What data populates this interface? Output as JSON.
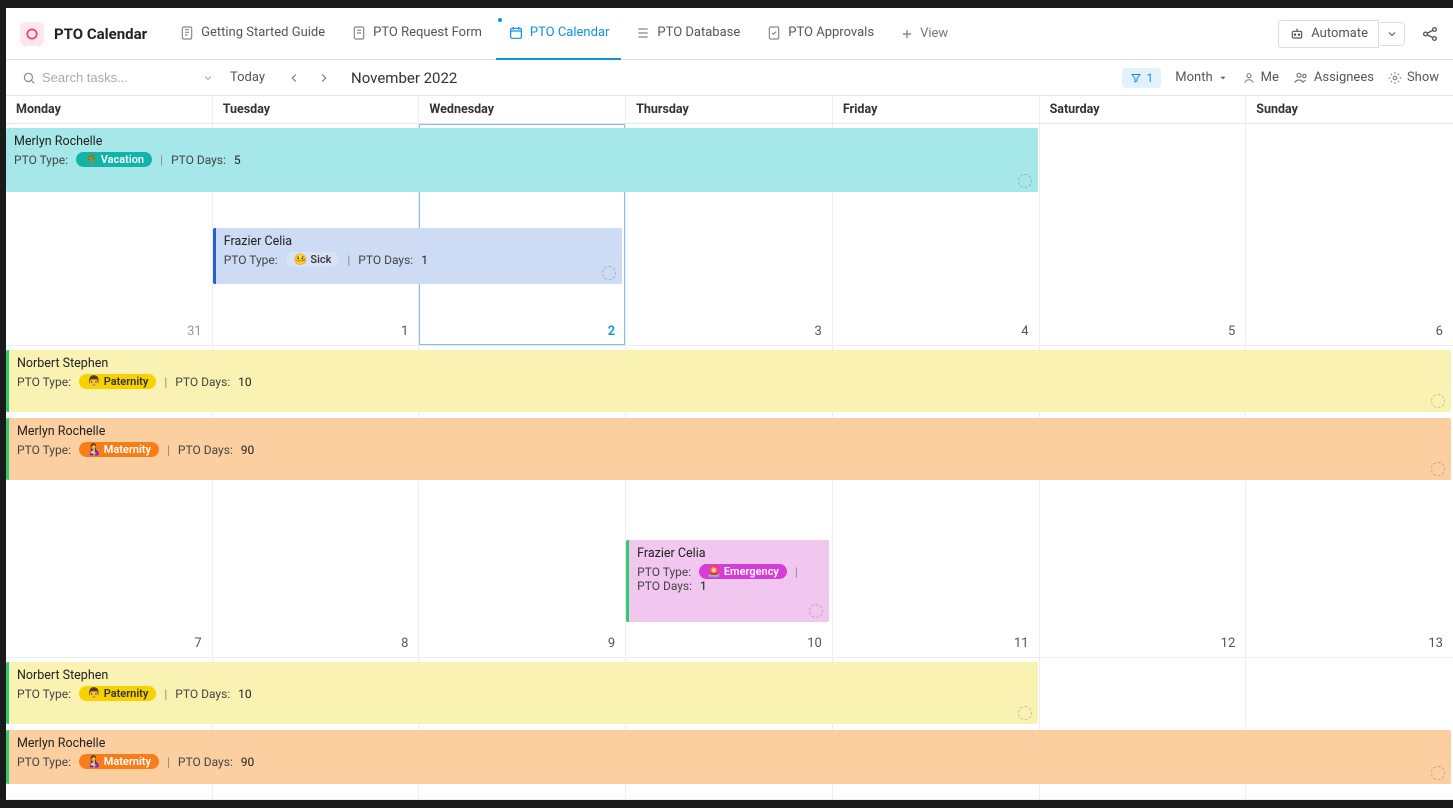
{
  "workspace": {
    "title": "PTO Calendar"
  },
  "tabs": [
    {
      "label": "Getting Started Guide"
    },
    {
      "label": "PTO Request Form"
    },
    {
      "label": "PTO Calendar"
    },
    {
      "label": "PTO Database"
    },
    {
      "label": "PTO Approvals"
    }
  ],
  "addView": "View",
  "automate": "Automate",
  "toolbar": {
    "searchPlaceholder": "Search tasks...",
    "today": "Today",
    "monthLabel": "November 2022",
    "filterCount": "1",
    "viewMode": "Month",
    "me": "Me",
    "assignees": "Assignees",
    "show": "Show"
  },
  "days": [
    "Monday",
    "Tuesday",
    "Wednesday",
    "Thursday",
    "Friday",
    "Saturday",
    "Sunday"
  ],
  "dates": {
    "row1": [
      "31",
      "1",
      "2",
      "3",
      "4",
      "5",
      "6"
    ],
    "row2": [
      "7",
      "8",
      "9",
      "10",
      "11",
      "12",
      "13"
    ]
  },
  "labels": {
    "ptoType": "PTO Type:",
    "ptoDays": "PTO Days:"
  },
  "events": {
    "e1": {
      "name": "Merlyn Rochelle",
      "type": "Vacation",
      "typeIcon": "🌴",
      "days": "5"
    },
    "e2": {
      "name": "Frazier Celia",
      "type": "Sick",
      "typeIcon": "🤒",
      "days": "1"
    },
    "e3": {
      "name": "Norbert Stephen",
      "type": "Paternity",
      "typeIcon": "👨",
      "days": "10"
    },
    "e4": {
      "name": "Merlyn Rochelle",
      "type": "Maternity",
      "typeIcon": "🤱",
      "days": "90"
    },
    "e5": {
      "name": "Frazier Celia",
      "type": "Emergency",
      "typeIcon": "🚨",
      "days": "1"
    },
    "e6": {
      "name": "Norbert Stephen",
      "type": "Paternity",
      "typeIcon": "👨",
      "days": "10"
    },
    "e7": {
      "name": "Merlyn Rochelle",
      "type": "Maternity",
      "typeIcon": "🤱",
      "days": "90"
    }
  }
}
